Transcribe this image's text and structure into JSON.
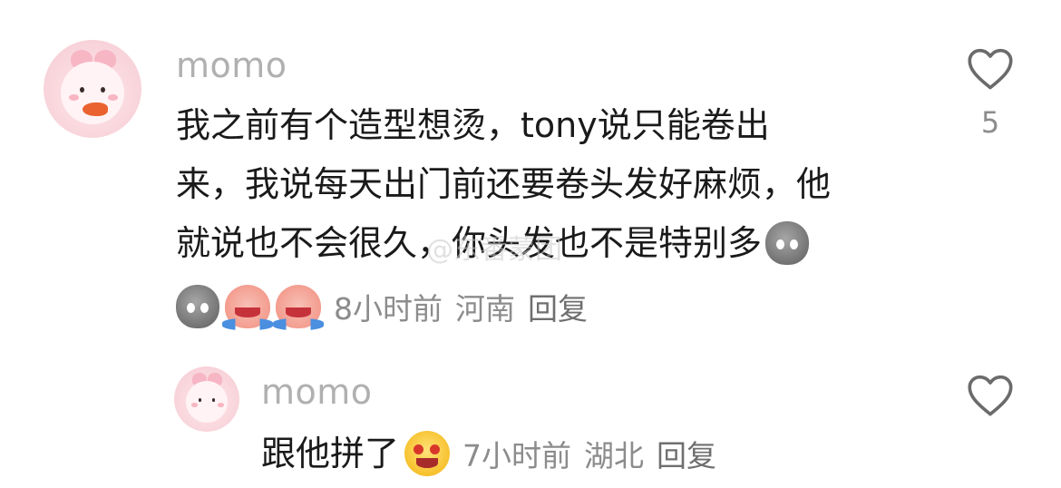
{
  "comments": [
    {
      "username": "momo",
      "lines": [
        "我之前有个造型想烫，tony说只能卷出",
        "来，我说每天出门前还要卷头发好麻烦，他",
        "就说也不会很久，你头发也不是特别多"
      ],
      "trailing_emoji": "gray-shocked-emoji",
      "meta_emojis": [
        "gray-shocked-emoji",
        "crying-laugh-emoji",
        "crying-laugh-emoji"
      ],
      "time": "8小时前",
      "location": "河南",
      "reply_label": "回复",
      "like_count": "5"
    },
    {
      "username": "momo",
      "text": "跟他拼了",
      "trailing_emoji": "big-laugh-emoji",
      "time": "7小时前",
      "location": "湖北",
      "reply_label": "回复",
      "like_count": ""
    }
  ],
  "watermark": "@东番蒙团",
  "colors": {
    "username": "#b0b0b0",
    "text": "#1a1a1a",
    "meta": "#8c8c8c"
  }
}
